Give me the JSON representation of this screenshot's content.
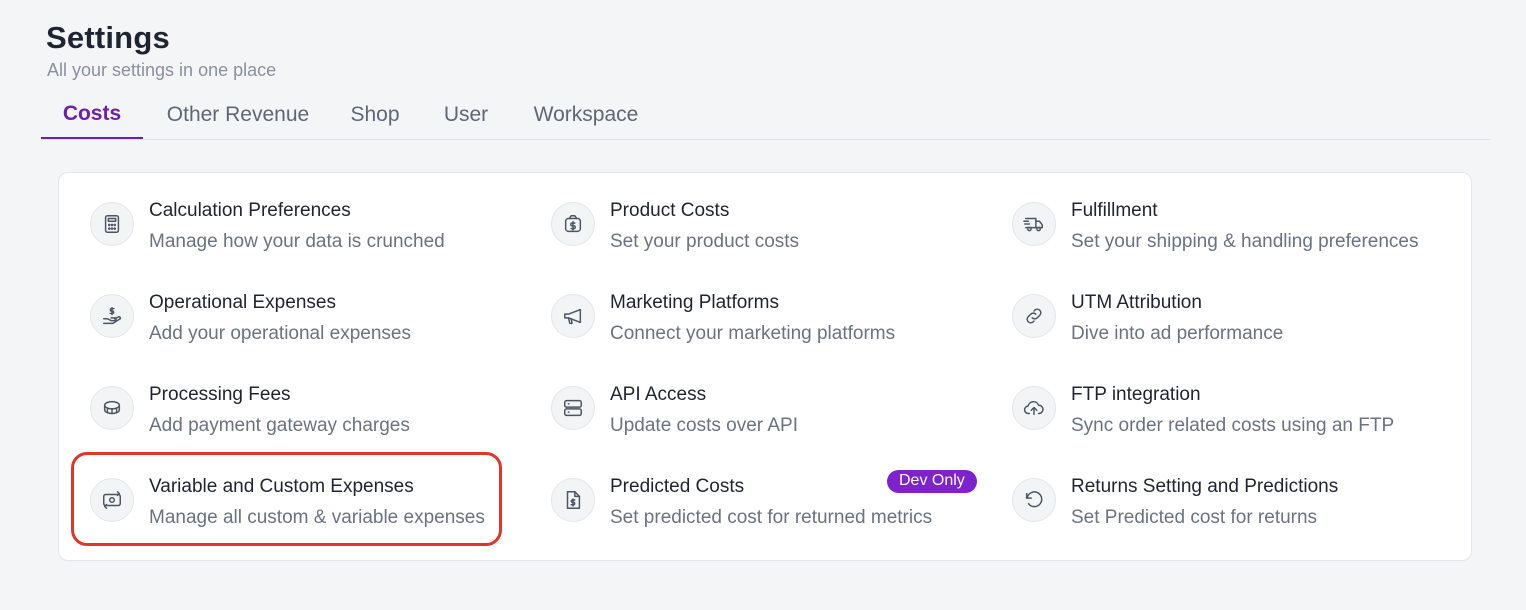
{
  "header": {
    "title": "Settings",
    "subtitle": "All your settings in one place"
  },
  "tabs": [
    {
      "label": "Costs",
      "active": true
    },
    {
      "label": "Other Revenue",
      "active": false
    },
    {
      "label": "Shop",
      "active": false
    },
    {
      "label": "User",
      "active": false
    },
    {
      "label": "Workspace",
      "active": false
    }
  ],
  "items": [
    {
      "title": "Calculation Preferences",
      "desc": "Manage how your data is crunched",
      "icon": "calculator-icon"
    },
    {
      "title": "Product Costs",
      "desc": "Set your product costs",
      "icon": "dollar-box-icon"
    },
    {
      "title": "Fulfillment",
      "desc": "Set your shipping & handling preferences",
      "icon": "truck-icon"
    },
    {
      "title": "Operational Expenses",
      "desc": "Add your operational expenses",
      "icon": "hand-dollar-icon"
    },
    {
      "title": "Marketing Platforms",
      "desc": "Connect your marketing platforms",
      "icon": "megaphone-icon"
    },
    {
      "title": "UTM Attribution",
      "desc": "Dive into ad performance",
      "icon": "link-icon"
    },
    {
      "title": "Processing Fees",
      "desc": "Add payment gateway charges",
      "icon": "coins-icon"
    },
    {
      "title": "API Access",
      "desc": "Update costs over API",
      "icon": "server-icon"
    },
    {
      "title": "FTP integration",
      "desc": "Sync order related costs using an FTP",
      "icon": "cloud-upload-icon"
    },
    {
      "title": "Variable and Custom Expenses",
      "desc": "Manage all custom & variable expenses",
      "icon": "cash-exchange-icon"
    },
    {
      "title": "Predicted Costs",
      "desc": "Set predicted cost for returned metrics",
      "icon": "dollar-document-icon",
      "badge": "Dev Only"
    },
    {
      "title": "Returns Setting and Predictions",
      "desc": "Set Predicted cost for returns",
      "icon": "rotate-ccw-icon"
    }
  ],
  "colors": {
    "accent": "#6b21a8",
    "badge": "#7e22ce",
    "highlight": "#e0352b"
  }
}
